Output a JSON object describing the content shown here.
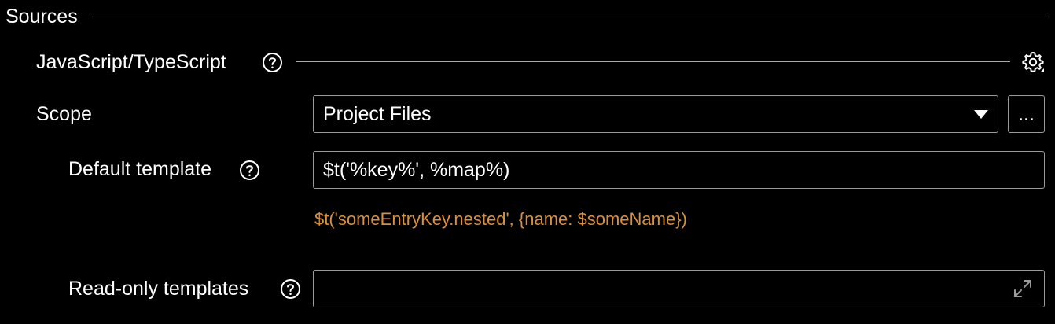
{
  "section": {
    "title": "Sources"
  },
  "subsection": {
    "title": "JavaScript/TypeScript",
    "help_icon": "question-circle-icon",
    "settings_icon": "gear-icon"
  },
  "scope": {
    "label": "Scope",
    "selected_value": "Project Files",
    "dropdown_icon": "caret-down-icon",
    "browse_label": "..."
  },
  "default_template": {
    "label": "Default template",
    "value": "$t('%key%', %map%)",
    "example": "$t('someEntryKey.nested', {name: $someName})",
    "example_color": "#d98f3e"
  },
  "readonly_templates": {
    "label": "Read-only templates",
    "value": "",
    "expand_icon": "expand-icon"
  }
}
